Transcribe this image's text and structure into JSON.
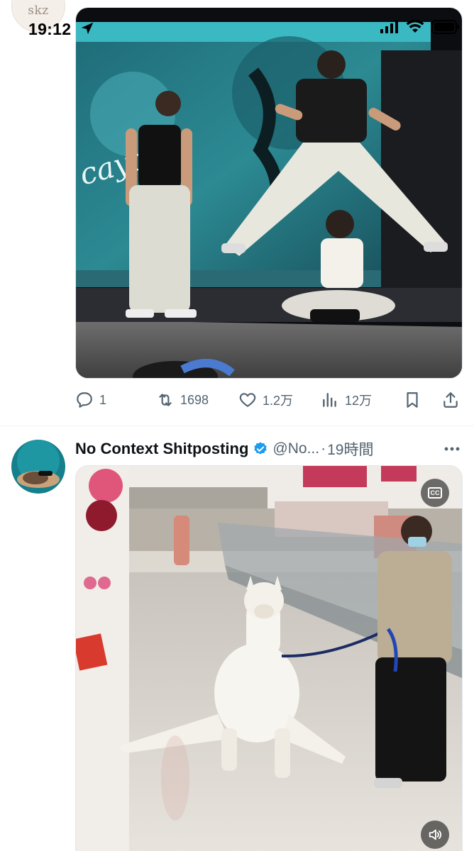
{
  "status_bar": {
    "time": "19:12"
  },
  "prev_tweet": {
    "avatar_text": "skz",
    "media_alt": "concert-stage-photo",
    "actions": {
      "reply_count": "1",
      "retweet_count": "1698",
      "like_count": "1.2万",
      "view_count": "12万"
    }
  },
  "tweet": {
    "name": "No Context Shitposting",
    "handle": "@No...",
    "separator": "·",
    "time": "19時間",
    "media_alt": "alpaca-in-mall-video"
  },
  "icons": {
    "location": "location-arrow-icon",
    "signal": "cellular-signal-icon",
    "wifi": "wifi-icon",
    "battery": "battery-icon",
    "reply": "reply-icon",
    "retweet": "retweet-icon",
    "like": "heart-icon",
    "views": "views-icon",
    "bookmark": "bookmark-icon",
    "share": "share-icon",
    "verified": "verified-badge-icon",
    "more": "more-icon",
    "cc": "closed-captions-icon",
    "volume": "volume-icon"
  },
  "colors": {
    "accent": "#1d9bf0",
    "muted": "#536471",
    "text": "#0f1419"
  }
}
